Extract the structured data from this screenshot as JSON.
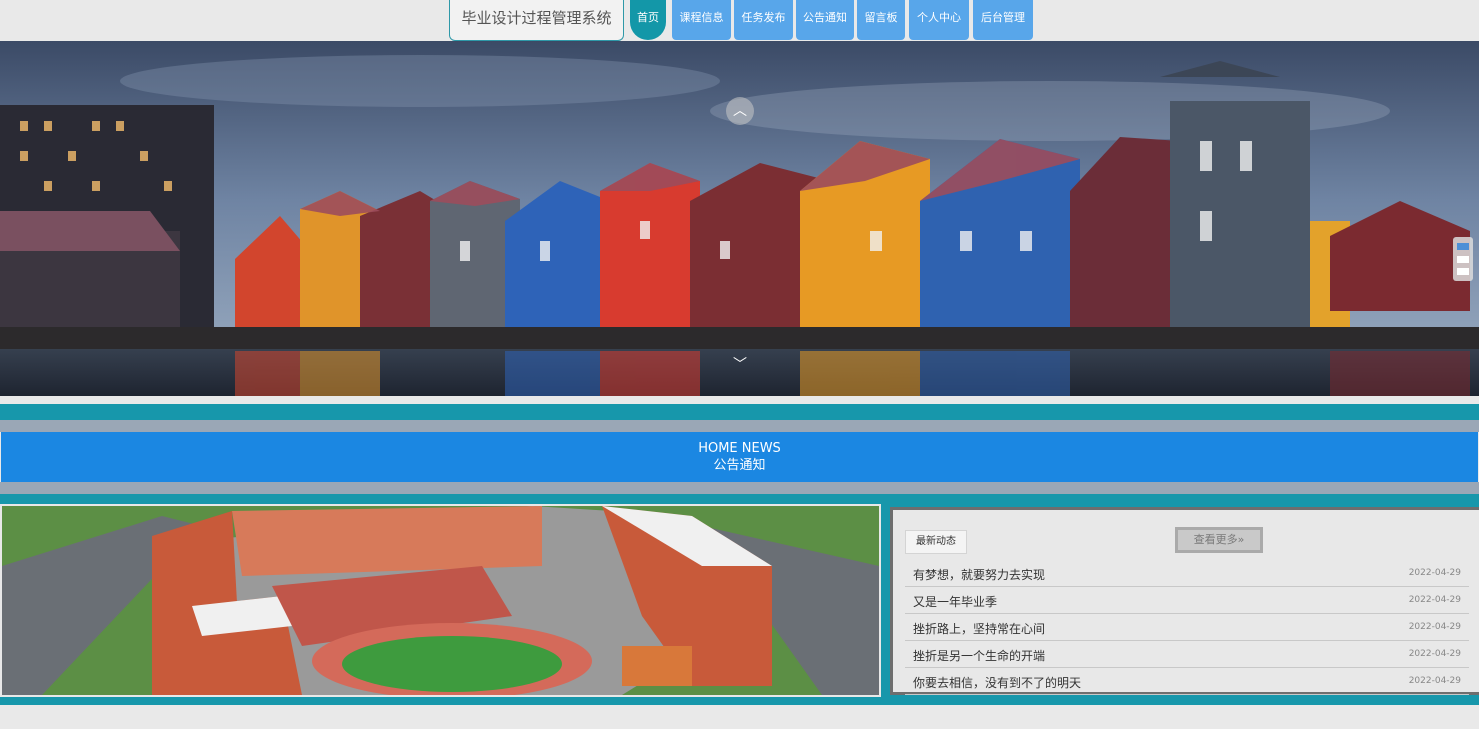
{
  "header": {
    "site_title": "毕业设计过程管理系统",
    "nav": [
      {
        "label": "首页",
        "active": true
      },
      {
        "label": "课程信息"
      },
      {
        "label": "任务发布"
      },
      {
        "label": "公告通知"
      },
      {
        "label": "留言板"
      },
      {
        "label": "个人中心"
      },
      {
        "label": "后台管理"
      }
    ]
  },
  "banner": {
    "prev_icon": "chevron-up-icon",
    "next_icon": "chevron-down-icon"
  },
  "news_section": {
    "heading_en": "HOME NEWS",
    "heading_cn": "公告通知"
  },
  "news_panel": {
    "latest_label": "最新动态",
    "more_label": "查看更多»",
    "items": [
      {
        "title": "有梦想，就要努力去实现",
        "date": "2022-04-29"
      },
      {
        "title": "又是一年毕业季",
        "date": "2022-04-29"
      },
      {
        "title": "挫折路上，坚持常在心间",
        "date": "2022-04-29"
      },
      {
        "title": "挫折是另一个生命的开端",
        "date": "2022-04-29"
      },
      {
        "title": "你要去相信，没有到不了的明天",
        "date": "2022-04-29"
      }
    ]
  },
  "colors": {
    "nav_blue": "#58a6ea",
    "nav_active": "#1397a8",
    "teal_band": "#1797ab",
    "news_blue": "#1b87e2"
  }
}
